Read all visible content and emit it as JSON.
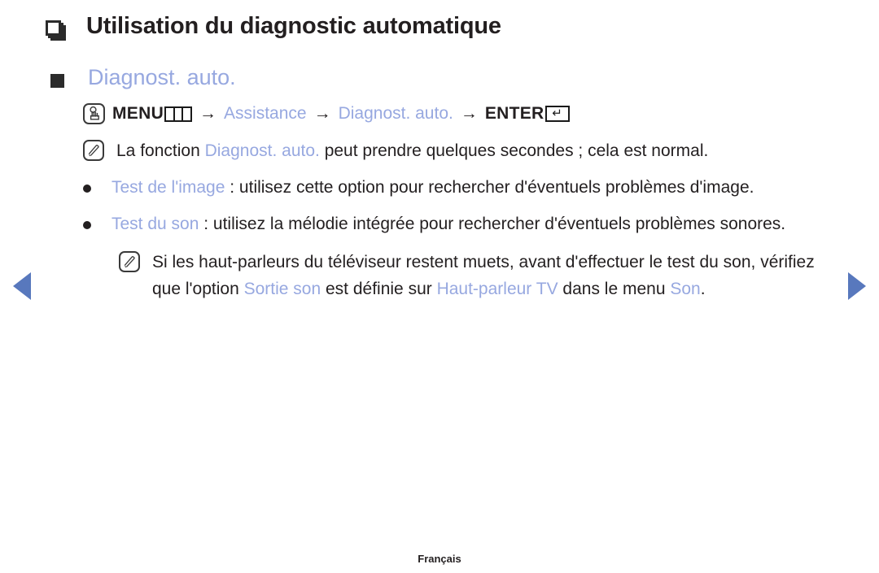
{
  "page": {
    "accent_color": "#97a8e0",
    "text_color": "#231f20",
    "arrow_color": "#5878bd",
    "background": "#ffffff"
  },
  "nav": {
    "prev_label": "◀",
    "next_label": "▶"
  },
  "heading": {
    "icon": "stacked-pages-icon",
    "title": "Utilisation du diagnostic automatique"
  },
  "subheading": {
    "icon": "filled-square-bullet",
    "title": "Diagnost. auto."
  },
  "menu_path": {
    "icon": "press-button-icon",
    "menu_label": "MENU",
    "menu_glyph": "menu-grid-glyph",
    "arrow": "→",
    "step1": "Assistance",
    "step2": "Diagnost. auto.",
    "enter_label": "ENTER",
    "enter_glyph": "↵"
  },
  "notes": [
    {
      "icon": "note-pencil-icon",
      "parts": [
        {
          "text": "La fonction ",
          "accent": false
        },
        {
          "text": "Diagnost. auto.",
          "accent": true
        },
        {
          "text": " peut prendre quelques secondes ; cela est normal.",
          "accent": false
        }
      ]
    }
  ],
  "bullets": [
    {
      "parts": [
        {
          "text": "Test de l'image",
          "accent": true
        },
        {
          "text": " : utilisez cette option pour rechercher d'éventuels problèmes d'image.",
          "accent": false
        }
      ]
    },
    {
      "parts": [
        {
          "text": "Test du son",
          "accent": true
        },
        {
          "text": " : utilisez la mélodie intégrée pour rechercher d'éventuels problèmes sonores.",
          "accent": false
        }
      ]
    }
  ],
  "nested_note": {
    "icon": "note-pencil-icon",
    "parts": [
      {
        "text": "Si les haut-parleurs du téléviseur restent muets, avant d'effectuer le test du son, vérifiez que l'option ",
        "accent": false
      },
      {
        "text": "Sortie son",
        "accent": true
      },
      {
        "text": " est définie sur ",
        "accent": false
      },
      {
        "text": "Haut-parleur TV",
        "accent": true
      },
      {
        "text": " dans le menu ",
        "accent": false
      },
      {
        "text": "Son",
        "accent": true
      },
      {
        "text": ".",
        "accent": false
      }
    ]
  },
  "footer": {
    "language": "Français"
  }
}
